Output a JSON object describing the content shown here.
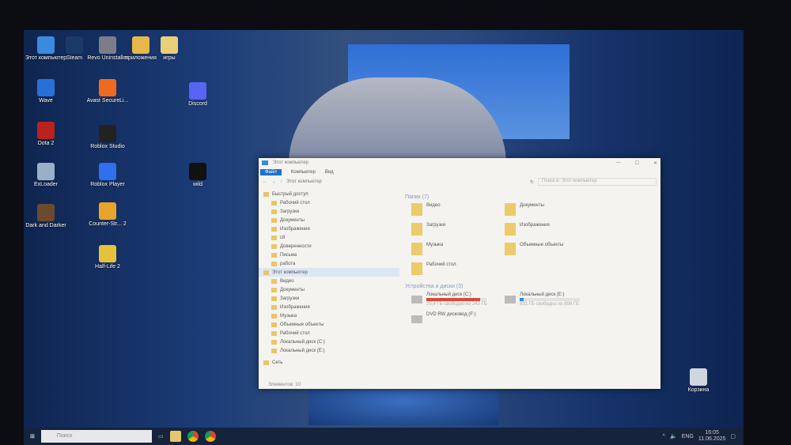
{
  "desktop": {
    "icons": [
      {
        "label": "Этот компьютер",
        "color": "#3a8be0"
      },
      {
        "label": "Steam",
        "color": "#1c3a66"
      },
      {
        "label": "Revo Uninstaller",
        "color": "#7d7d8a"
      },
      {
        "label": "приложения",
        "color": "#e6b84a"
      },
      {
        "label": "игры",
        "color": "#e8d07a"
      },
      {
        "label": "Wave",
        "color": "#2a6fd8"
      },
      {
        "label": "Avast SecureLi...",
        "color": "#f06a1e"
      },
      {
        "label": "Discord",
        "color": "#5865f2"
      },
      {
        "label": "Dota 2",
        "color": "#b8231d"
      },
      {
        "label": "Roblox Studio",
        "color": "#222"
      },
      {
        "label": "ExLoader",
        "color": "#9ab0c8"
      },
      {
        "label": "Roblox Player",
        "color": "#2f6ff0"
      },
      {
        "label": "wild",
        "color": "#111"
      },
      {
        "label": "Dark and Darker",
        "color": "#6b4a2e"
      },
      {
        "label": "Counter-Str... 2",
        "color": "#e6a52a"
      },
      {
        "label": "Half-Life 2",
        "color": "#e6c23a"
      },
      {
        "label": "Корзина",
        "color": "#cfd6de"
      }
    ]
  },
  "explorer": {
    "title": "Этот компьютер",
    "ribbon": [
      "Файл",
      "Компьютер",
      "Вид"
    ],
    "address": "Этот компьютер",
    "search_placeholder": "Поиск в: Этот компьютер",
    "nav": [
      "Быстрый доступ",
      "Рабочий стол",
      "Загрузки",
      "Документы",
      "Изображения",
      "с8",
      "Доверенности",
      "Письма",
      "работа",
      "Этот компьютер",
      "Видео",
      "Документы",
      "Загрузки",
      "Изображения",
      "Музыка",
      "Объемные объекты",
      "Рабочий стол",
      "Локальный диск (C:)",
      "Локальный диск (E:)",
      "Сеть"
    ],
    "folders_header": "Папки (7)",
    "folders": [
      "Видео",
      "Документы",
      "Загрузки",
      "Изображения",
      "Музыка",
      "Объемные объекты",
      "Рабочий стол"
    ],
    "drives_header": "Устройства и диски (3)",
    "drives": [
      {
        "name": "Локальный диск (C:)",
        "free": "25,4 ГБ свободно из 243 ГБ",
        "used_fraction": 0.9,
        "color": "#d9493b"
      },
      {
        "name": "Локальный диск (E:)",
        "free": "831 ГБ свободно из 898 ГБ",
        "used_fraction": 0.07,
        "color": "#2a8ee0"
      },
      {
        "name": "DVD RW дисковод (F:)"
      }
    ],
    "status": "Элементов: 10"
  },
  "taskbar": {
    "search_placeholder": "Поиск",
    "lang": "ENG",
    "time": "16:05",
    "date": "11.06.2025"
  }
}
